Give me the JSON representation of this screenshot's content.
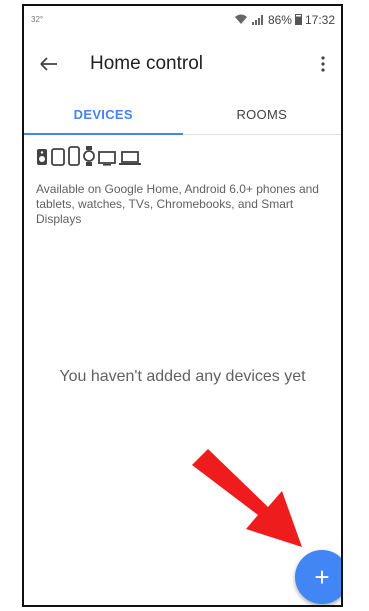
{
  "status_bar": {
    "left": "32°",
    "battery_pct": "86%",
    "time": "17:32"
  },
  "appbar": {
    "title": "Home control"
  },
  "tabs": [
    {
      "label": "DEVICES",
      "active": true
    },
    {
      "label": "ROOMS",
      "active": false
    }
  ],
  "device_icons": [
    "speaker-icon",
    "tablet-icon",
    "phone-icon",
    "watch-icon",
    "tv-icon",
    "laptop-icon"
  ],
  "availability_text": "Available on Google Home, Android 6.0+ phones and tablets, watches, TVs, Chromebooks, and Smart Displays",
  "empty_state": "You haven't added any devices yet",
  "fab": {
    "label": "+"
  },
  "colors": {
    "accent": "#4285f4",
    "arrow": "#ee1c1c"
  }
}
